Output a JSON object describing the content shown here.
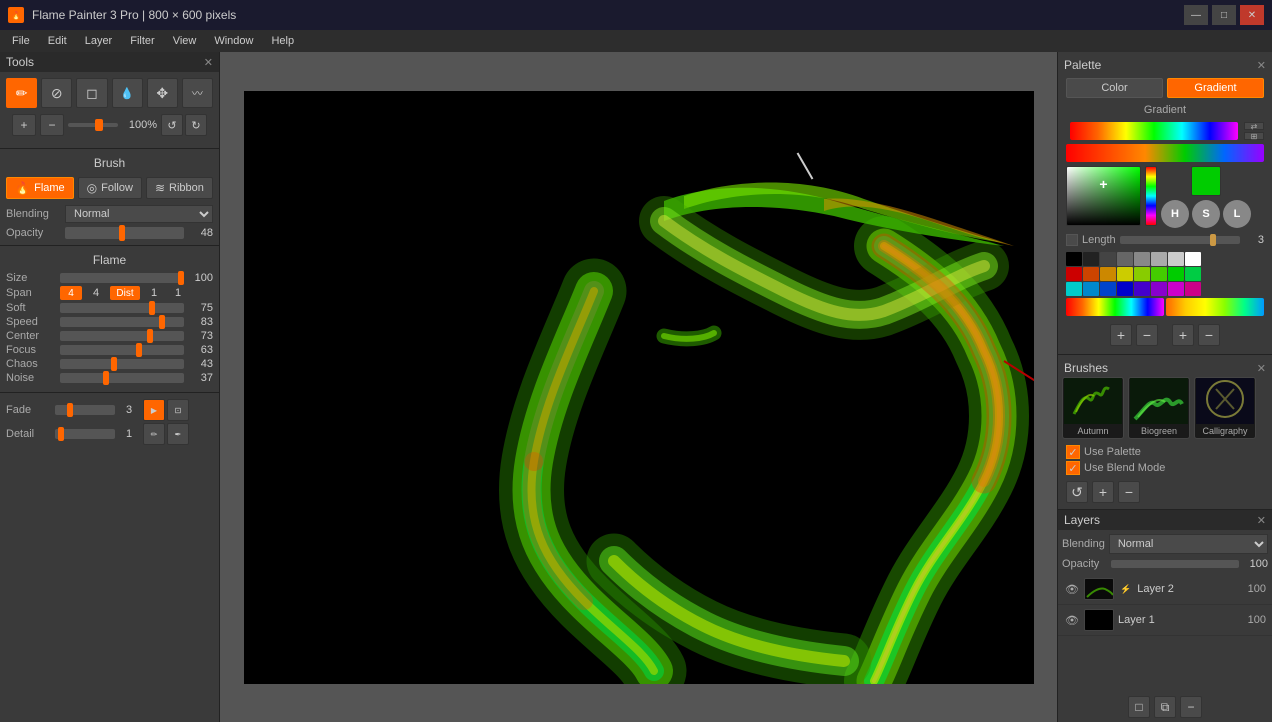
{
  "titlebar": {
    "title": "Flame Painter 3 Pro | 800 × 600 pixels",
    "icon": "🔥",
    "min": "—",
    "max": "□",
    "close": "✕"
  },
  "menu": {
    "items": [
      "File",
      "Edit",
      "Layer",
      "Filter",
      "View",
      "Window",
      "Help"
    ]
  },
  "tools_panel": {
    "header": "Tools",
    "tools": [
      {
        "id": "brush",
        "icon": "✏",
        "active": true
      },
      {
        "id": "pen",
        "icon": "🖊"
      },
      {
        "id": "eraser",
        "icon": "◻"
      },
      {
        "id": "dropper",
        "icon": "💧"
      },
      {
        "id": "transform",
        "icon": "✥"
      },
      {
        "id": "wave",
        "icon": "〰"
      }
    ],
    "zoom_in": "+",
    "zoom_out": "−",
    "zoom_pct": "100%",
    "reset": "↺",
    "refresh": "↻"
  },
  "brush": {
    "header": "Brush",
    "mode_flame": "Flame",
    "mode_follow": "Follow",
    "mode_ribbon": "Ribbon",
    "blending_label": "Blending",
    "blending_value": "Normal",
    "opacity_label": "Opacity",
    "opacity_value": "48"
  },
  "flame": {
    "header": "Flame",
    "size": {
      "label": "Size",
      "value": "100",
      "pct": 100
    },
    "span": {
      "label": "Span",
      "box_val": "4",
      "dist_label": "Dist",
      "dist_val": "1"
    },
    "soft": {
      "label": "Soft",
      "value": "75",
      "pct": 75
    },
    "speed": {
      "label": "Speed",
      "value": "83",
      "pct": 83
    },
    "center": {
      "label": "Center",
      "value": "73",
      "pct": 73
    },
    "focus": {
      "label": "Focus",
      "value": "63",
      "pct": 63
    },
    "chaos": {
      "label": "Chaos",
      "value": "43",
      "pct": 43
    },
    "noise": {
      "label": "Noise",
      "value": "37",
      "pct": 37
    },
    "fade": {
      "label": "Fade",
      "value": "3"
    },
    "detail": {
      "label": "Detail",
      "value": "1"
    }
  },
  "palette": {
    "header": "Palette",
    "close": "✕",
    "tab_color": "Color",
    "tab_gradient": "Gradient",
    "gradient_label": "Gradient",
    "length_label": "Length",
    "length_value": "3",
    "hsl_h": "H",
    "hsl_s": "S",
    "hsl_l": "L"
  },
  "brushes_panel": {
    "header": "Brushes",
    "close": "✕",
    "items": [
      {
        "name": "Autumn",
        "color": "#3a7a2a"
      },
      {
        "name": "Biogreen",
        "color": "#2a6a3a"
      },
      {
        "name": "Calligraphy",
        "color": "#2a2a3a"
      }
    ],
    "use_palette": "Use Palette",
    "use_blend": "Use Blend Mode"
  },
  "layers": {
    "header": "Layers",
    "close": "✕",
    "blending_label": "Blending",
    "blending_value": "Normal",
    "opacity_label": "Opacity",
    "opacity_value": "100",
    "items": [
      {
        "name": "Layer 2",
        "opacity": "100",
        "visible": true,
        "has_fx": true
      },
      {
        "name": "Layer 1",
        "opacity": "100",
        "visible": true,
        "has_fx": false
      }
    ],
    "add_btn": "+",
    "dupe_btn": "⧉",
    "delete_btn": "−"
  },
  "swatches": {
    "grays": [
      "#000000",
      "#222222",
      "#444444",
      "#666666",
      "#888888",
      "#aaaaaa",
      "#cccccc",
      "#ffffff"
    ],
    "row1": [
      "#cc0000",
      "#cc4400",
      "#cc8800",
      "#cccc00",
      "#88cc00",
      "#44cc00",
      "#00cc00",
      "#00cc44"
    ],
    "row2": [
      "#00cccc",
      "#0088cc",
      "#0044cc",
      "#0000cc",
      "#4400cc",
      "#8800cc",
      "#cc00cc",
      "#cc0088"
    ]
  }
}
